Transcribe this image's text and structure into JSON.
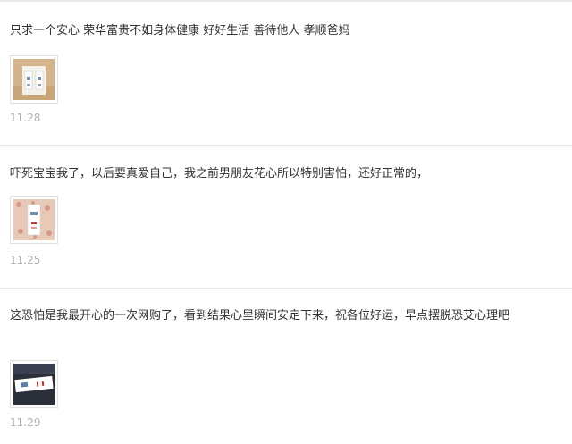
{
  "reviews": [
    {
      "text": "只求一个安心 荣华富贵不如身体健康 好好生活 善待他人 孝顺爸妈",
      "thumbnail_icon": "photo-test-strip-icon",
      "date": "11.28"
    },
    {
      "text": "吓死宝宝我了，以后要真爱自己，我之前男朋友花心所以特别害怕，还好正常的，",
      "thumbnail_icon": "photo-test-strip-icon",
      "date": "11.25"
    },
    {
      "text": "这恐怕是我最开心的一次网购了，看到结果心里瞬间安定下来，祝各位好运，早点摆脱恐艾心理吧",
      "thumbnail_icon": "photo-test-strip-icon",
      "date": "11.29"
    }
  ],
  "colors": {
    "text": "#333333",
    "date": "#b0b0b0",
    "divider": "#e6e6e6"
  }
}
